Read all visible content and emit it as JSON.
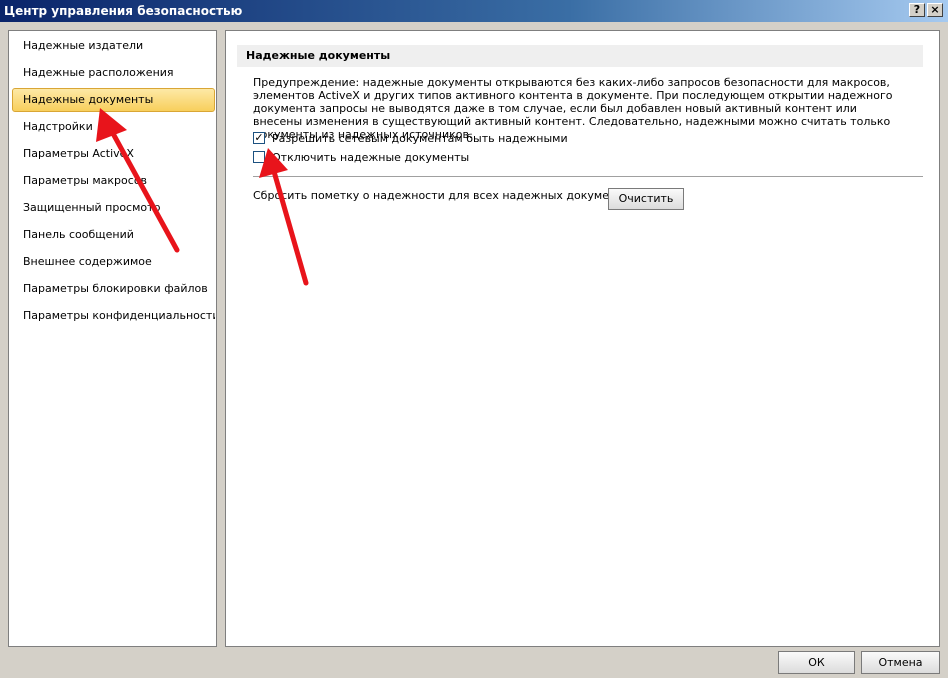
{
  "window": {
    "title": "Центр управления безопасностью",
    "help_glyph": "?",
    "close_glyph": "×"
  },
  "sidebar": {
    "items": [
      {
        "label": "Надежные издатели"
      },
      {
        "label": "Надежные расположения"
      },
      {
        "label": "Надежные документы",
        "selected": true
      },
      {
        "label": "Надстройки"
      },
      {
        "label": "Параметры ActiveX"
      },
      {
        "label": "Параметры макросов"
      },
      {
        "label": "Защищенный просмотр"
      },
      {
        "label": "Панель сообщений"
      },
      {
        "label": "Внешнее содержимое"
      },
      {
        "label": "Параметры блокировки файлов"
      },
      {
        "label": "Параметры конфиденциальности"
      }
    ]
  },
  "main": {
    "section_title": "Надежные документы",
    "warning_text": "Предупреждение: надежные документы открываются без каких-либо запросов безопасности для макросов, элементов ActiveX и других типов активного контента в документе. При последующем открытии надежного документа запросы не выводятся даже в том случае, если был добавлен новый активный контент или внесены изменения в существующий активный контент. Следовательно, надежными можно считать только документы из надежных источников.",
    "allow_network": {
      "label": "Разрешить сетевым документам быть надежными",
      "checked": true
    },
    "disable_trusted": {
      "label": "Отключить надежные документы",
      "checked": false
    },
    "reset_label": "Сбросить пометку о надежности для всех надежных документов",
    "clear_button": "Очистить"
  },
  "footer": {
    "ok": "ОК",
    "cancel": "Отмена"
  },
  "colors": {
    "selection": "#f8cf5c",
    "annotation_arrow": "#e8141b"
  }
}
